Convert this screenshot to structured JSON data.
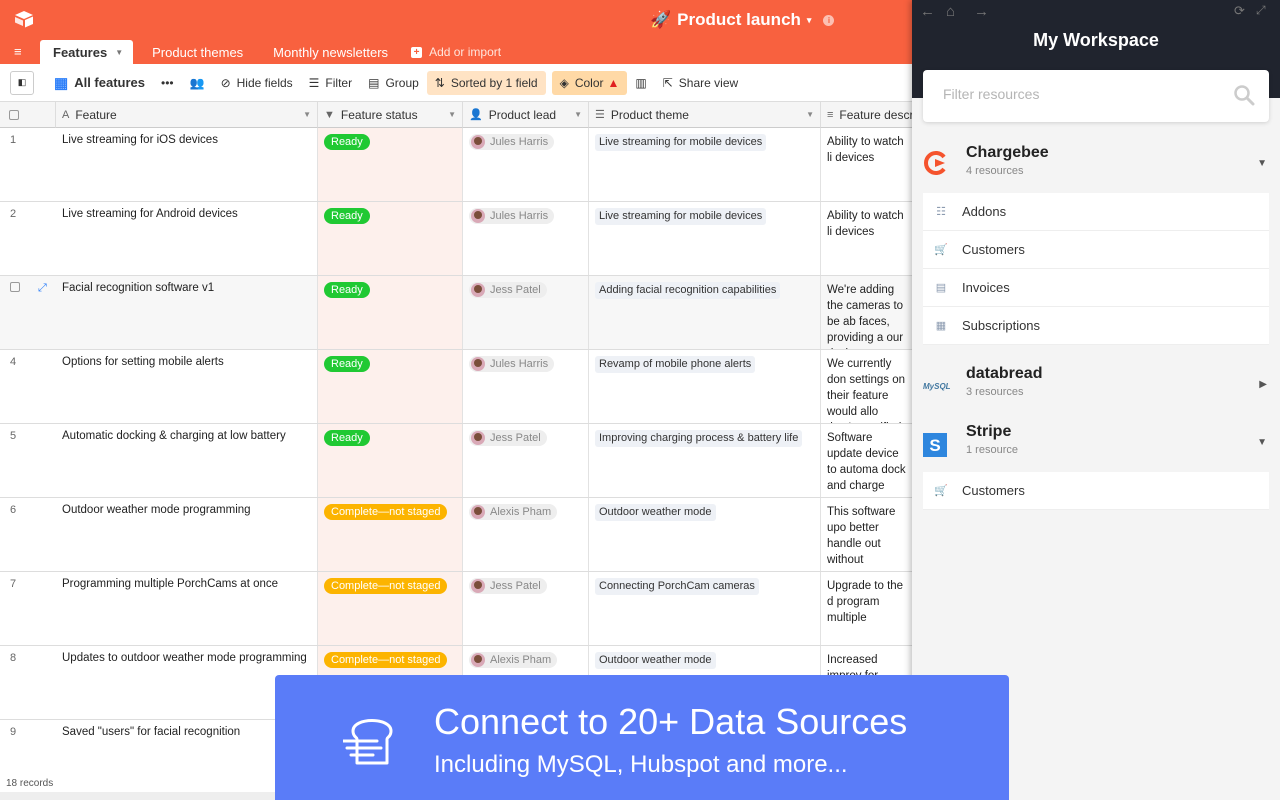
{
  "app": {
    "base_name": "Product launch",
    "caret": "▾",
    "info": "i",
    "menu_icon": "≡"
  },
  "tabs": [
    {
      "label": "Features",
      "active": true
    },
    {
      "label": "Product themes"
    },
    {
      "label": "Monthly newsletters"
    },
    {
      "label": "Add or import",
      "add": true
    }
  ],
  "toolbar": {
    "view_name": "All features",
    "more": "•••",
    "hide_fields": "Hide fields",
    "filter": "Filter",
    "group": "Group",
    "sorted": "Sorted by 1 field",
    "color": "Color",
    "share_view": "Share view"
  },
  "columns": [
    {
      "label": "Feature",
      "icon": "A"
    },
    {
      "label": "Feature status",
      "icon": "▼"
    },
    {
      "label": "Product lead",
      "icon": "👤"
    },
    {
      "label": "Product theme",
      "icon": "☰"
    },
    {
      "label": "Feature descr",
      "icon": "≡"
    }
  ],
  "rows": [
    {
      "num": "1",
      "feature": "Live streaming for iOS devices",
      "status": "Ready",
      "status_type": "ready",
      "lead": "Jules Harris",
      "theme": "Live streaming for mobile devices",
      "desc": "Ability to watch li devices"
    },
    {
      "num": "2",
      "feature": "Live streaming for Android devices",
      "status": "Ready",
      "status_type": "ready",
      "lead": "Jules Harris",
      "theme": "Live streaming for mobile devices",
      "desc": "Ability to watch li devices"
    },
    {
      "num": "",
      "feature": "Facial recognition software v1",
      "status": "Ready",
      "status_type": "ready",
      "lead": "Jess Patel",
      "theme": "Adding facial recognition capabilities",
      "desc": "We're adding the cameras to be ab faces, providing a our devices."
    },
    {
      "num": "4",
      "feature": "Options for setting mobile alerts",
      "status": "Ready",
      "status_type": "ready",
      "lead": "Jules Harris",
      "theme": "Revamp of mobile phone alerts",
      "desc": "We currently don settings on their feature would allo they're notified"
    },
    {
      "num": "5",
      "feature": "Automatic docking & charging at low battery",
      "status": "Ready",
      "status_type": "ready",
      "lead": "Jess Patel",
      "theme": "Improving charging process & battery life",
      "desc": "Software update device to automa dock and charge"
    },
    {
      "num": "6",
      "feature": "Outdoor weather mode programming",
      "status": "Complete—not staged",
      "status_type": "complete",
      "lead": "Alexis Pham",
      "theme": "Outdoor weather mode",
      "desc": "This software upo better handle out without comprom"
    },
    {
      "num": "7",
      "feature": "Programming multiple PorchCams at once",
      "status": "Complete—not staged",
      "status_type": "complete",
      "lead": "Jess Patel",
      "theme": "Connecting PorchCam cameras",
      "desc": "Upgrade to the d program multiple"
    },
    {
      "num": "8",
      "feature": "Updates to outdoor weather mode programming",
      "status": "Complete—not staged",
      "status_type": "complete",
      "lead": "Alexis Pham",
      "theme": "Outdoor weather mode",
      "desc": "Increased improv for navigating in c"
    },
    {
      "num": "9",
      "feature": "Saved \"users\" for facial recognition",
      "status": "",
      "status_type": "",
      "lead": "",
      "theme": "",
      "desc": ""
    }
  ],
  "footer": {
    "records": "18 records"
  },
  "panel": {
    "title": "My Workspace",
    "filter_placeholder": "Filter resources",
    "sources": [
      {
        "name": "Chargebee",
        "count": "4 resources",
        "expanded": true,
        "resources": [
          {
            "label": "Addons",
            "icon": "list-icon"
          },
          {
            "label": "Customers",
            "icon": "cart-icon"
          },
          {
            "label": "Invoices",
            "icon": "document-icon"
          },
          {
            "label": "Subscriptions",
            "icon": "register-icon"
          }
        ]
      },
      {
        "name": "databread",
        "count": "3 resources",
        "expanded": false,
        "logo_text": "MySQL",
        "resources": []
      },
      {
        "name": "Stripe",
        "count": "1 resource",
        "expanded": true,
        "logo_text": "S",
        "resources": [
          {
            "label": "Customers",
            "icon": "cart-icon"
          }
        ]
      }
    ]
  },
  "banner": {
    "headline": "Connect to 20+ Data Sources",
    "subline": "Including MySQL, Hubspot and more..."
  },
  "colors": {
    "brand": "#f8613f",
    "ready": "#20c933",
    "complete": "#fcb400",
    "banner": "#5a7cf8",
    "panel_header": "#20242e"
  }
}
